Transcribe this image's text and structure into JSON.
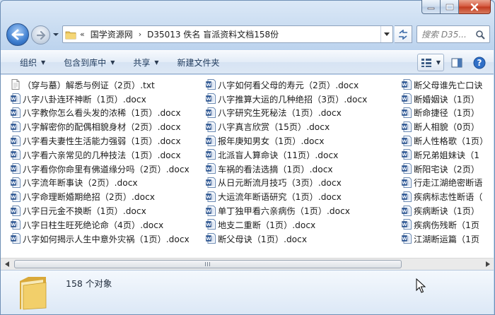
{
  "window": {
    "buttons": {
      "minimize": "minimize",
      "maximize": "maximize",
      "close": "close"
    }
  },
  "address": {
    "chevron": "«",
    "crumbs": [
      "国学资源网",
      "D35013 佚名 盲派资料文档158份"
    ],
    "separator": "›"
  },
  "search": {
    "placeholder": "搜索 D35..."
  },
  "toolbar": {
    "organize": "组织",
    "include_in_library": "包含到库中",
    "share": "共享",
    "new_folder": "新建文件夹"
  },
  "files": {
    "col1": [
      {
        "name": "（穿与墓）解悉与例证（2页）.txt",
        "type": "txt"
      },
      {
        "name": "八字八卦连环神断（1页）.docx",
        "type": "docx"
      },
      {
        "name": "八字教你怎么看头发的浓稀（1页）.docx",
        "type": "docx"
      },
      {
        "name": "八字解密你的配偶相貌身材（2页）.docx",
        "type": "docx"
      },
      {
        "name": "八字看夫妻性生活能力强弱（1页）.docx",
        "type": "docx"
      },
      {
        "name": "八字看六亲常见的几种技法（1页）.docx",
        "type": "docx"
      },
      {
        "name": "八字看你你命里有佛道缘分吗（2页）.docx",
        "type": "docx"
      },
      {
        "name": "八字流年断事诀（2页）.docx",
        "type": "docx"
      },
      {
        "name": "八字命理断婚期绝招（2页）.docx",
        "type": "docx"
      },
      {
        "name": "八字日元金不换断（1页）.docx",
        "type": "docx"
      },
      {
        "name": "八字日柱生旺死绝论命（4页）.docx",
        "type": "docx"
      },
      {
        "name": "八字如何揭示人生中意外灾祸（1页）.docx",
        "type": "docx"
      }
    ],
    "col2": [
      {
        "name": "八字如何看父母的寿元（2页）.docx",
        "type": "docx"
      },
      {
        "name": "八字推算大运的几种绝招（3页）.docx",
        "type": "docx"
      },
      {
        "name": "八字研究生死秘法（1页）.docx",
        "type": "docx"
      },
      {
        "name": "八字真言欣赏（15页）.docx",
        "type": "docx"
      },
      {
        "name": "报年庚知男女（1页）.docx",
        "type": "docx"
      },
      {
        "name": "北派盲人算命诀（11页）.docx",
        "type": "docx"
      },
      {
        "name": "车祸的看法选摘（1页）.docx",
        "type": "docx"
      },
      {
        "name": "从日元断流月技巧（3页）.docx",
        "type": "docx"
      },
      {
        "name": "大运流年断语研究（1页）.docx",
        "type": "docx"
      },
      {
        "name": "单丁独甲看六亲病伤（1页）.docx",
        "type": "docx"
      },
      {
        "name": "地支二重断（1页）.docx",
        "type": "docx"
      },
      {
        "name": "断父母诀（1页）.docx",
        "type": "docx"
      }
    ],
    "col3": [
      {
        "name": "断父母谁先亡口诀",
        "type": "docx"
      },
      {
        "name": "断婚姻诀（1页）",
        "type": "docx"
      },
      {
        "name": "断命捷径（1页）",
        "type": "docx"
      },
      {
        "name": "断人相貌（0页）",
        "type": "docx"
      },
      {
        "name": "断人性格歌（1页）",
        "type": "docx"
      },
      {
        "name": "断兄弟姐妹诀（1",
        "type": "docx"
      },
      {
        "name": "断阳宅诀（2页）",
        "type": "docx"
      },
      {
        "name": "行走江湖绝密断语",
        "type": "docx"
      },
      {
        "name": "疾病标志性断语（",
        "type": "docx"
      },
      {
        "name": "疾病断诀（1页）",
        "type": "docx"
      },
      {
        "name": "疾病伤残断（1页",
        "type": "docx"
      },
      {
        "name": "江湖断运篇（1页",
        "type": "docx"
      }
    ]
  },
  "status": {
    "count_text": "158 个对象"
  },
  "colors": {
    "window_bg": "#c9dcf1",
    "accent": "#3f7fd0",
    "close": "#c13a1e"
  }
}
